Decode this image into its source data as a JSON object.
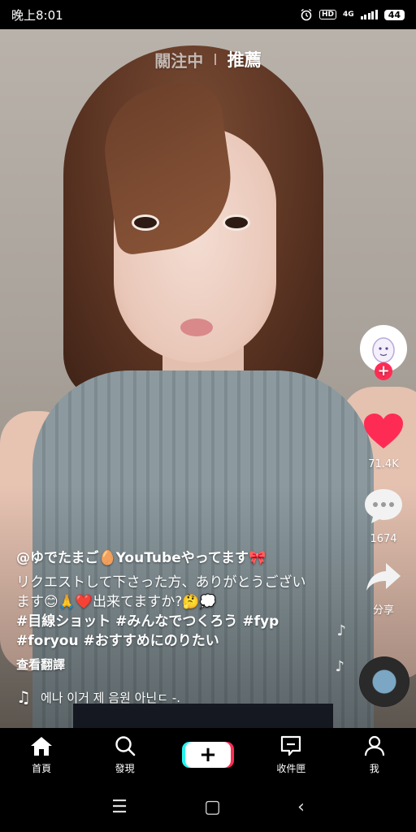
{
  "status": {
    "time": "晚上8:01",
    "hd": "HD",
    "network": "4G",
    "battery": "44"
  },
  "top_tabs": [
    {
      "label": "關注中",
      "active": false
    },
    {
      "label": "推薦",
      "active": true
    }
  ],
  "side": {
    "likes": "71.4K",
    "comments": "1674",
    "share_label": "分享"
  },
  "post": {
    "username": "@ゆでたまご🥚YouTubeやってます🎀",
    "description": "リクエストして下さった方、ありがとうございます😊🙏❤️出来てますか?🤔💭",
    "hashtags": "#目線ショット #みんなでつくろう #fyp #foryou #おすすめにのりたい",
    "translate": "查看翻譯",
    "sound": "에나 이거 제 음원 아닌ㄷ -."
  },
  "nav": {
    "home": "首頁",
    "discover": "發現",
    "inbox": "收件匣",
    "me": "我"
  },
  "colors": {
    "accent_red": "#fe2c55",
    "accent_cyan": "#25f4ee"
  }
}
